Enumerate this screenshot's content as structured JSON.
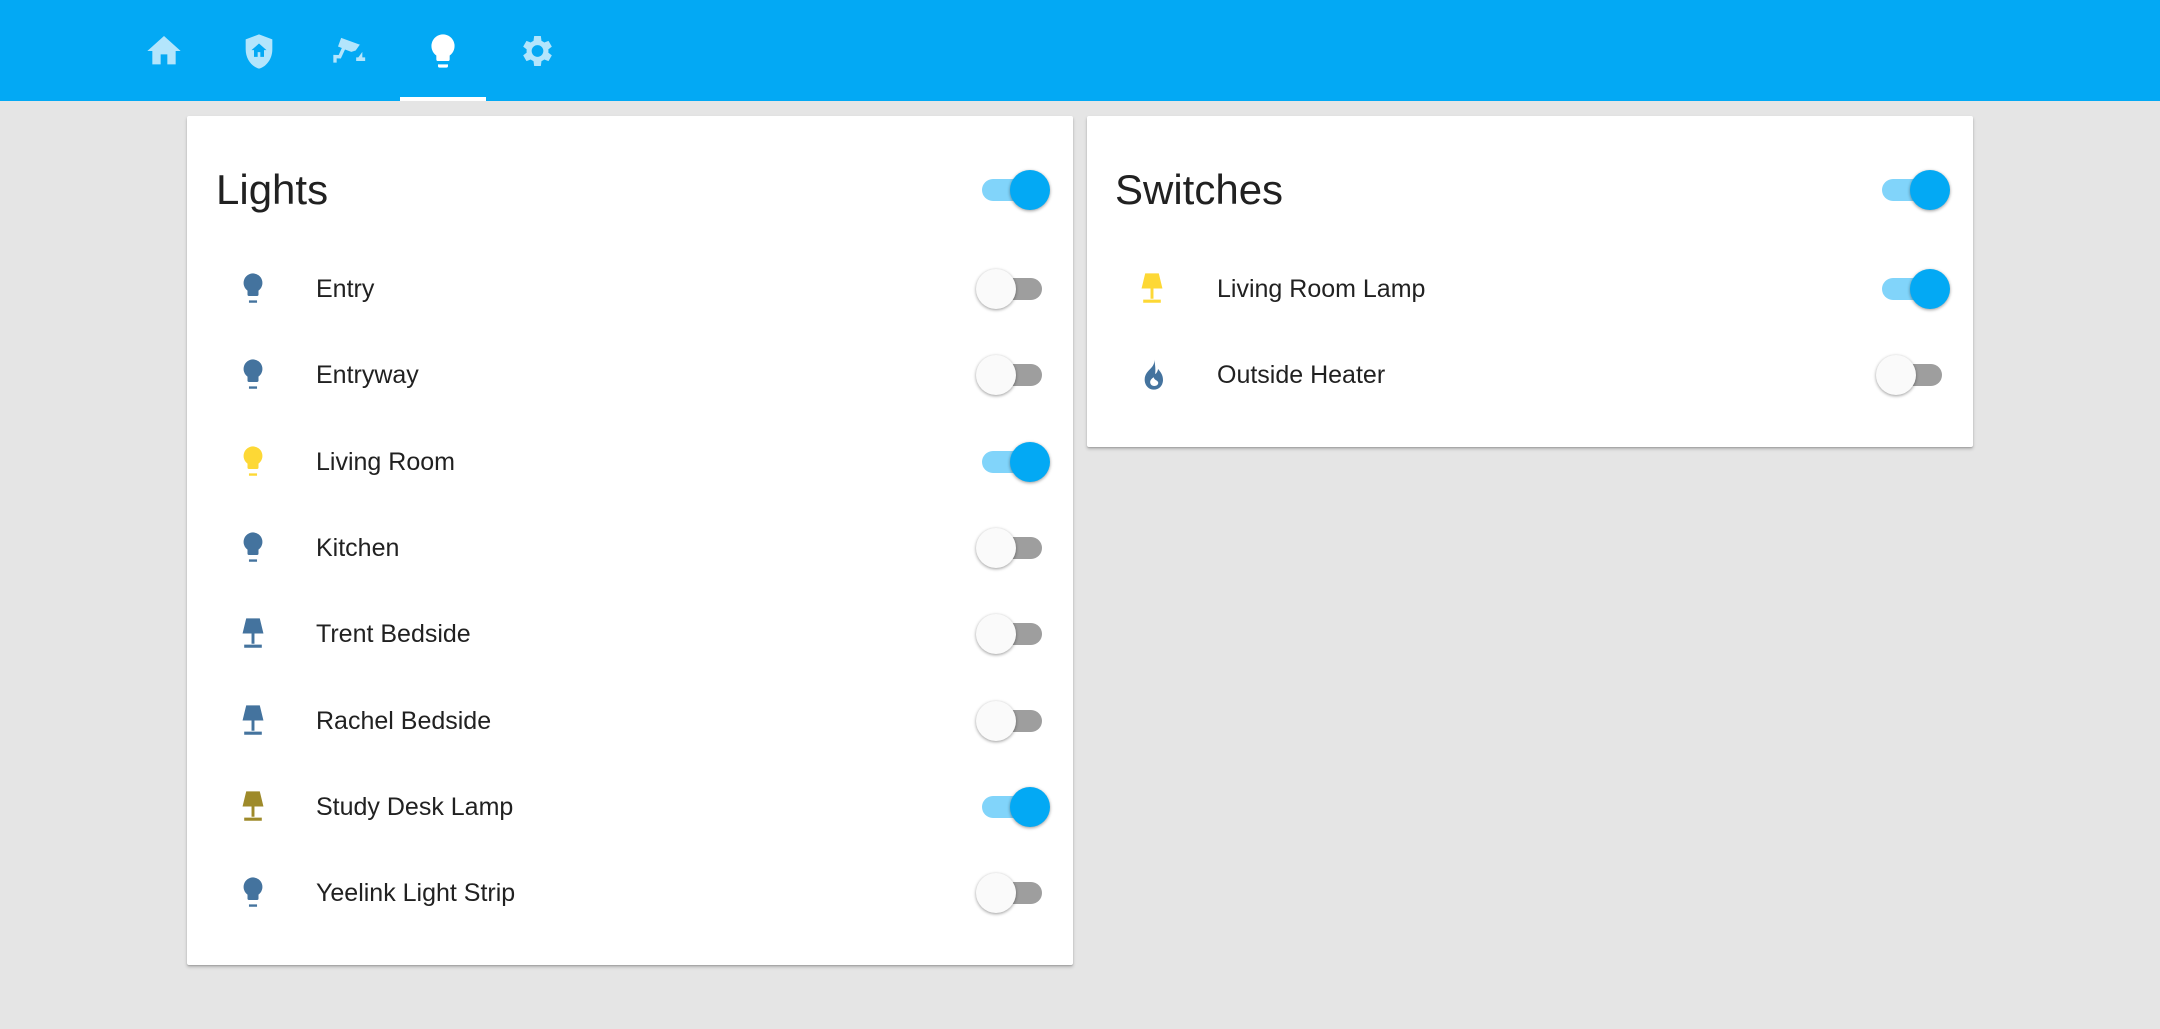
{
  "nav": {
    "tabs": [
      {
        "name": "home",
        "icon": "home-icon"
      },
      {
        "name": "security",
        "icon": "shield-home-icon"
      },
      {
        "name": "cameras",
        "icon": "cctv-icon"
      },
      {
        "name": "lights",
        "icon": "lightbulb-icon",
        "active": true
      },
      {
        "name": "settings",
        "icon": "gear-icon"
      }
    ]
  },
  "lights": {
    "title": "Lights",
    "all_on": true,
    "items": [
      {
        "label": "Entry",
        "icon": "lightbulb-icon",
        "on": false
      },
      {
        "label": "Entryway",
        "icon": "lightbulb-icon",
        "on": false
      },
      {
        "label": "Living Room",
        "icon": "lightbulb-icon",
        "on": true
      },
      {
        "label": "Kitchen",
        "icon": "lightbulb-icon",
        "on": false
      },
      {
        "label": "Trent Bedside",
        "icon": "lamp-icon",
        "on": false
      },
      {
        "label": "Rachel Bedside",
        "icon": "lamp-icon",
        "on": false
      },
      {
        "label": "Study Desk Lamp",
        "icon": "lamp-icon",
        "on": true
      },
      {
        "label": "Yeelink Light Strip",
        "icon": "lightbulb-icon",
        "on": false
      }
    ]
  },
  "switches": {
    "title": "Switches",
    "all_on": true,
    "items": [
      {
        "label": "Living Room Lamp",
        "icon": "lamp-icon",
        "on": true
      },
      {
        "label": "Outside Heater",
        "icon": "fire-icon",
        "on": false
      }
    ]
  },
  "colors": {
    "header": "#03a9f4",
    "nav_icon": "#b3e5fc",
    "icon_off": "#44739e",
    "icon_on": "#fdd835",
    "icon_on_dim": "#9e8a2a",
    "toggle_on": "#03a9f4",
    "toggle_track_on": "#81d4fa",
    "toggle_off_track": "#9e9e9e"
  }
}
